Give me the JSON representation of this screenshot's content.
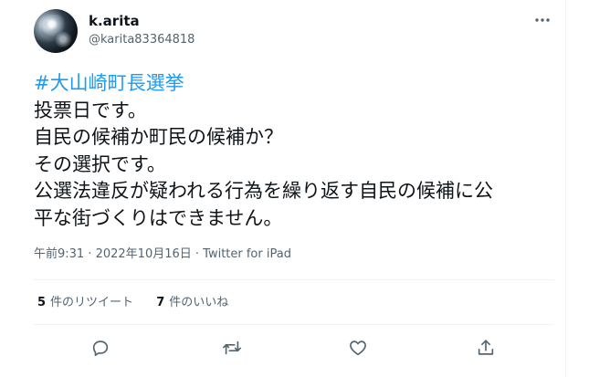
{
  "author": {
    "display_name": "k.arita",
    "handle": "@karita83364818"
  },
  "tweet": {
    "hashtag": "#大山崎町長選挙",
    "lines": [
      "投票日です。",
      "自民の候補か町民の候補か？",
      "その選択です。",
      "公選法違反が疑われる行為を繰り返す自民の候補に公",
      "平な街づくりはできません。"
    ],
    "meta": "午前9:31 · 2022年10月16日 · Twitter for iPad"
  },
  "stats": {
    "retweets_count": "5",
    "retweets_label": "件のリツイート",
    "likes_count": "7",
    "likes_label": "件のいいね"
  },
  "icons": {
    "more": "more-icon",
    "reply": "reply-icon",
    "retweet": "retweet-icon",
    "like": "like-icon",
    "share": "share-icon"
  },
  "colors": {
    "hashtag": "#1d9bf0",
    "secondary_text": "#536471",
    "primary_text": "#0f1419",
    "divider": "#eff3f4"
  }
}
